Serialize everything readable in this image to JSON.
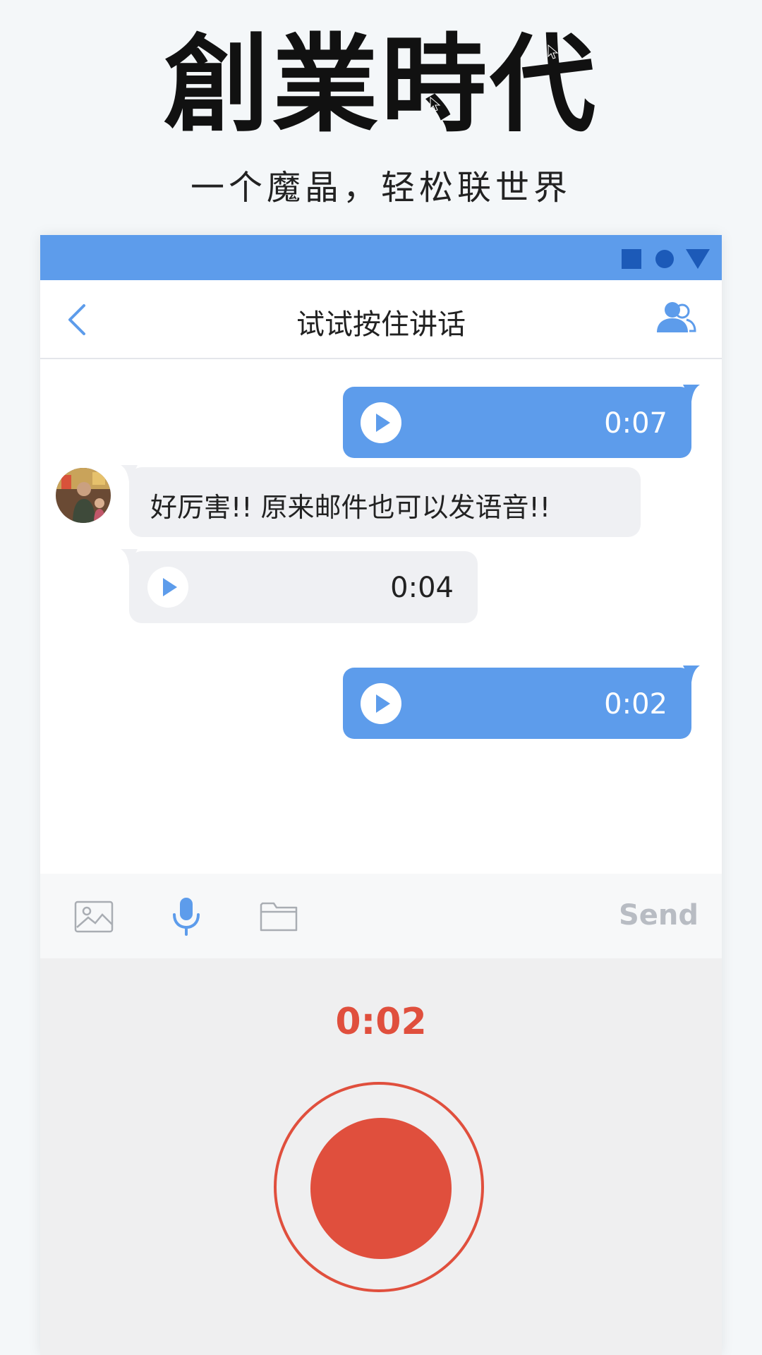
{
  "hero": {
    "title": "創業時代",
    "subtitle": "一个魔晶，轻松联世界"
  },
  "colors": {
    "accent": "#5d9ceb",
    "record": "#e04f3d",
    "incoming_bubble": "#eff0f3",
    "send_disabled": "#b8bcc3"
  },
  "status_bar": {
    "icons": [
      "square-icon",
      "circle-icon",
      "triangle-down-icon"
    ]
  },
  "nav": {
    "title": "试试按住讲话",
    "back_icon": "chevron-left-icon",
    "contacts_icon": "contacts-icon"
  },
  "messages": [
    {
      "direction": "outgoing",
      "type": "voice",
      "duration": "0:07"
    },
    {
      "direction": "incoming",
      "type": "text",
      "text": "好厉害!! 原来邮件也可以发语音!!"
    },
    {
      "direction": "incoming",
      "type": "voice",
      "duration": "0:04"
    },
    {
      "direction": "outgoing",
      "type": "voice",
      "duration": "0:02"
    }
  ],
  "toolbar": {
    "icons": [
      "image-icon",
      "microphone-icon",
      "folder-icon"
    ],
    "send_label": "Send"
  },
  "recorder": {
    "elapsed": "0:02"
  }
}
